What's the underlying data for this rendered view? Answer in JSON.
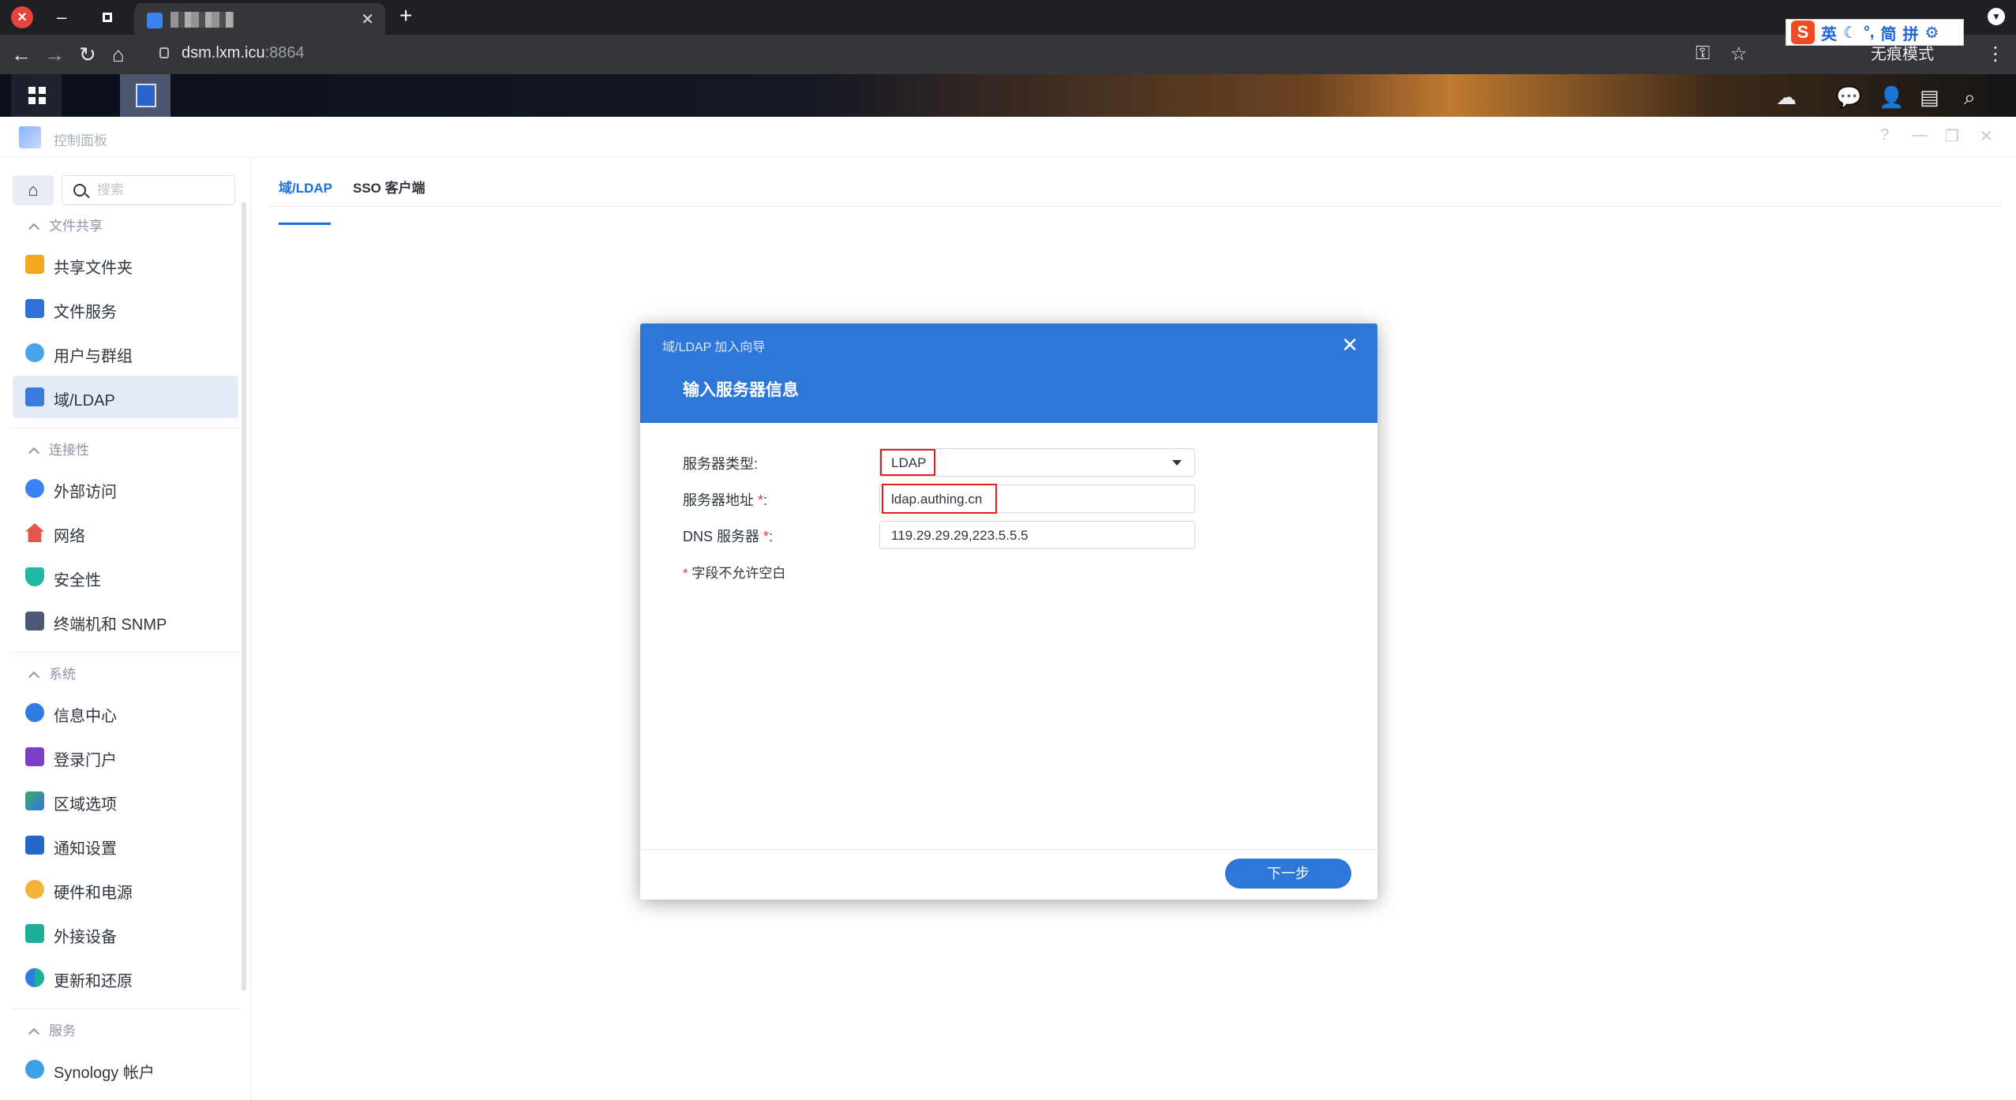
{
  "browser": {
    "tab_title": "",
    "url_host": "dsm.lxm.icu",
    "url_port": ":8864",
    "incognito_label": "无痕模式",
    "ime": {
      "lang": "英",
      "mode1": "简",
      "mode2": "拼"
    }
  },
  "window": {
    "title": "控制面板",
    "help": "?",
    "minimize": "—",
    "restore": "❐",
    "close": "✕"
  },
  "sidebar": {
    "search_placeholder": "搜索",
    "sections": [
      {
        "title": "文件共享",
        "items": [
          "共享文件夹",
          "文件服务",
          "用户与群组",
          "域/LDAP"
        ]
      },
      {
        "title": "连接性",
        "items": [
          "外部访问",
          "网络",
          "安全性",
          "终端机和 SNMP"
        ]
      },
      {
        "title": "系统",
        "items": [
          "信息中心",
          "登录门户",
          "区域选项",
          "通知设置",
          "硬件和电源",
          "外接设备",
          "更新和还原"
        ]
      },
      {
        "title": "服务",
        "items": [
          "Synology 帐户"
        ]
      }
    ],
    "active_item": "域/LDAP"
  },
  "main": {
    "tabs": [
      "域/LDAP",
      "SSO 客户端"
    ],
    "active_tab": "域/LDAP"
  },
  "dialog": {
    "wizard_title": "域/LDAP 加入向导",
    "heading": "输入服务器信息",
    "close": "✕",
    "fields": {
      "server_type_label": "服务器类型:",
      "server_type_value": "LDAP",
      "server_address_label": "服务器地址 ",
      "server_address_value": "ldap.authing.cn",
      "dns_label": "DNS 服务器 ",
      "dns_value": "119.29.29.29,223.5.5.5",
      "required_mark": "*",
      "colon": ":"
    },
    "note": "字段不允许空白",
    "next_button": "下一步"
  },
  "colors": {
    "accent": "#2e76d8",
    "highlight_box": "#e02020",
    "required": "#e5393d"
  }
}
